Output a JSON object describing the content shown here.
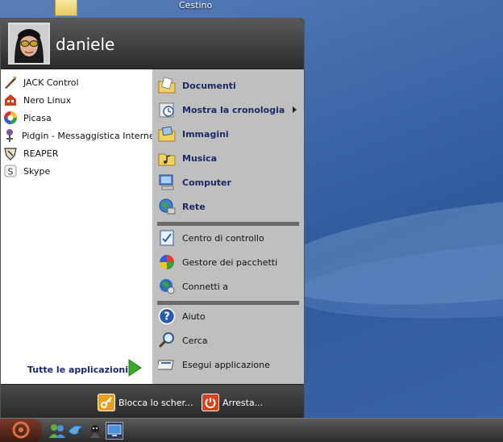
{
  "desktop": {
    "trash_label": "Cestino"
  },
  "user": {
    "name": "daniele"
  },
  "recent_apps": [
    {
      "label": "JACK Control",
      "icon": "jack-control-icon"
    },
    {
      "label": "Nero Linux",
      "icon": "nero-icon"
    },
    {
      "label": "Picasa",
      "icon": "picasa-icon"
    },
    {
      "label": "Pidgin - Messaggistica Internet",
      "icon": "pidgin-icon"
    },
    {
      "label": "REAPER",
      "icon": "reaper-icon"
    },
    {
      "label": "Skype",
      "icon": "skype-icon"
    }
  ],
  "all_apps_label": "Tutte le applicazioni",
  "places": [
    {
      "label": "Documenti",
      "icon": "documents-folder-icon"
    },
    {
      "label": "Mostra la cronologia",
      "icon": "history-icon",
      "has_submenu": true
    },
    {
      "label": "Immagini",
      "icon": "pictures-folder-icon"
    },
    {
      "label": "Musica",
      "icon": "music-folder-icon"
    },
    {
      "label": "Computer",
      "icon": "computer-icon"
    },
    {
      "label": "Rete",
      "icon": "network-icon"
    }
  ],
  "system": [
    {
      "label": "Centro di controllo",
      "icon": "control-center-icon"
    },
    {
      "label": "Gestore dei pacchetti",
      "icon": "package-manager-icon"
    },
    {
      "label": "Connetti a",
      "icon": "connect-icon"
    }
  ],
  "help": [
    {
      "label": "Aiuto",
      "icon": "help-icon"
    },
    {
      "label": "Cerca",
      "icon": "search-icon"
    },
    {
      "label": "Esegui applicazione",
      "icon": "run-application-icon"
    }
  ],
  "footer": {
    "lock_label": "Blocca lo scher...",
    "shutdown_label": "Arresta..."
  },
  "colors": {
    "desktop": "#3f69a8",
    "menu_right_pane": "#bfbfbf",
    "menu_left_pane": "#ffffff",
    "link_text": "#1a2a66"
  }
}
